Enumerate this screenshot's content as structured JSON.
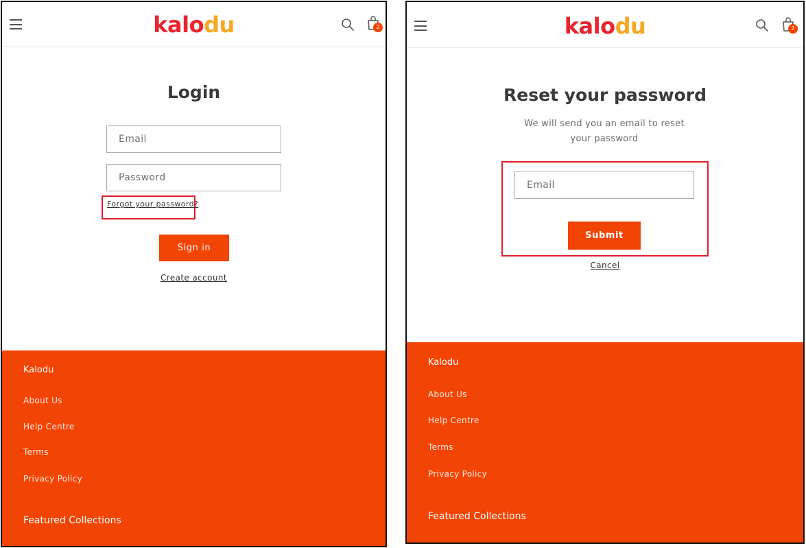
{
  "brand": {
    "logo_part1": "kalo",
    "logo_part2": "du",
    "logo_colors": {
      "primary": "#e8252e",
      "secondary": "#f7a823"
    }
  },
  "accent_color": "#f24405",
  "cart": {
    "count": "2"
  },
  "icons": [
    "menu-icon",
    "search-icon",
    "cart-icon"
  ],
  "login": {
    "title": "Login",
    "email_placeholder": "Email",
    "password_placeholder": "Password",
    "forgot_link": "Forgot your password?",
    "signin_button": "Sign in",
    "create_account_link": "Create account"
  },
  "reset": {
    "title": "Reset your password",
    "subtitle": "We will send you an email to reset your password",
    "email_placeholder": "Email",
    "submit_button": "Submit",
    "cancel_link": "Cancel"
  },
  "footer": {
    "heading": "Kalodu",
    "links": [
      "About Us",
      "Help Centre",
      "Terms",
      "Privacy Policy"
    ],
    "featured_heading": "Featured Collections"
  }
}
